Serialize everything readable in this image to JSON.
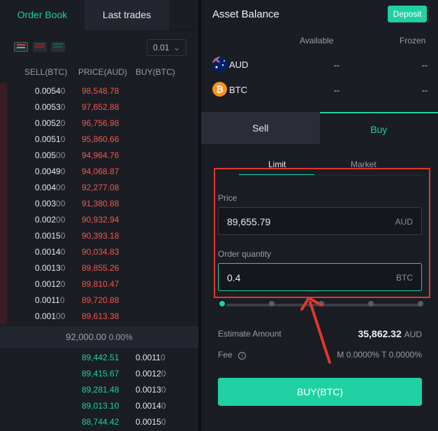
{
  "orderbook": {
    "tabs": [
      "Order Book",
      "Last trades"
    ],
    "precision": "0.01",
    "headers": {
      "sell": "SELL(BTC)",
      "price": "PRICE(AUD)",
      "buy": "BUY(BTC)"
    },
    "asks": [
      {
        "amt": "0.0054",
        "tail": "0",
        "price": "98,548.78"
      },
      {
        "amt": "0.0053",
        "tail": "0",
        "price": "97,652.88"
      },
      {
        "amt": "0.0052",
        "tail": "0",
        "price": "96,756.98"
      },
      {
        "amt": "0.0051",
        "tail": "0",
        "price": "95,860.66"
      },
      {
        "amt": "0.005",
        "tail": "00",
        "price": "94,964.76"
      },
      {
        "amt": "0.0049",
        "tail": "0",
        "price": "94,068.87"
      },
      {
        "amt": "0.004",
        "tail": "00",
        "price": "92,277.08"
      },
      {
        "amt": "0.003",
        "tail": "00",
        "price": "91,380.88"
      },
      {
        "amt": "0.002",
        "tail": "00",
        "price": "90,932.94"
      },
      {
        "amt": "0.0015",
        "tail": "0",
        "price": "90,393.18"
      },
      {
        "amt": "0.0014",
        "tail": "0",
        "price": "90,034.83"
      },
      {
        "amt": "0.0013",
        "tail": "0",
        "price": "89,855.26"
      },
      {
        "amt": "0.0012",
        "tail": "0",
        "price": "89,810.47"
      },
      {
        "amt": "0.0011",
        "tail": "0",
        "price": "89,720.88"
      },
      {
        "amt": "0.001",
        "tail": "00",
        "price": "89,613.38"
      }
    ],
    "mid_price": "92,000.00",
    "mid_change": "0.00%",
    "bids": [
      {
        "price": "89,442.51",
        "amt": "0.0011",
        "tail": "0"
      },
      {
        "price": "89,415.67",
        "amt": "0.0012",
        "tail": "0"
      },
      {
        "price": "89,281.48",
        "amt": "0.0013",
        "tail": "0"
      },
      {
        "price": "89,013.10",
        "amt": "0.0014",
        "tail": "0"
      },
      {
        "price": "88,744.42",
        "amt": "0.0015",
        "tail": "0"
      }
    ]
  },
  "balance": {
    "title": "Asset Balance",
    "deposit": "Deposit",
    "col_available": "Available",
    "col_frozen": "Frozen",
    "assets": [
      {
        "name": "AUD",
        "available": "--",
        "frozen": "--",
        "icon": "au-flag-icon"
      },
      {
        "name": "BTC",
        "available": "--",
        "frozen": "--",
        "icon": "bitcoin-icon"
      }
    ]
  },
  "trade": {
    "sell_tab": "Sell",
    "buy_tab": "Buy",
    "order_types": [
      "Limit",
      "Market"
    ],
    "price_label": "Price",
    "price_value": "89,655.79",
    "price_unit": "AUD",
    "qty_label": "Order quantity",
    "qty_value": "0.4",
    "qty_unit": "BTC",
    "slider_level_percent": 0,
    "estimate_label": "Estimate Amount",
    "estimate_value": "35,862.32",
    "estimate_unit": "AUD",
    "fee_label": "Fee",
    "fee_value": "M 0.0000% T 0.0000%",
    "buy_button": "BUY(BTC)"
  },
  "colors": {
    "accent": "#1fd1a2",
    "ask": "#f0574f",
    "bid": "#1fd1a2",
    "highlight": "#e0382c"
  }
}
